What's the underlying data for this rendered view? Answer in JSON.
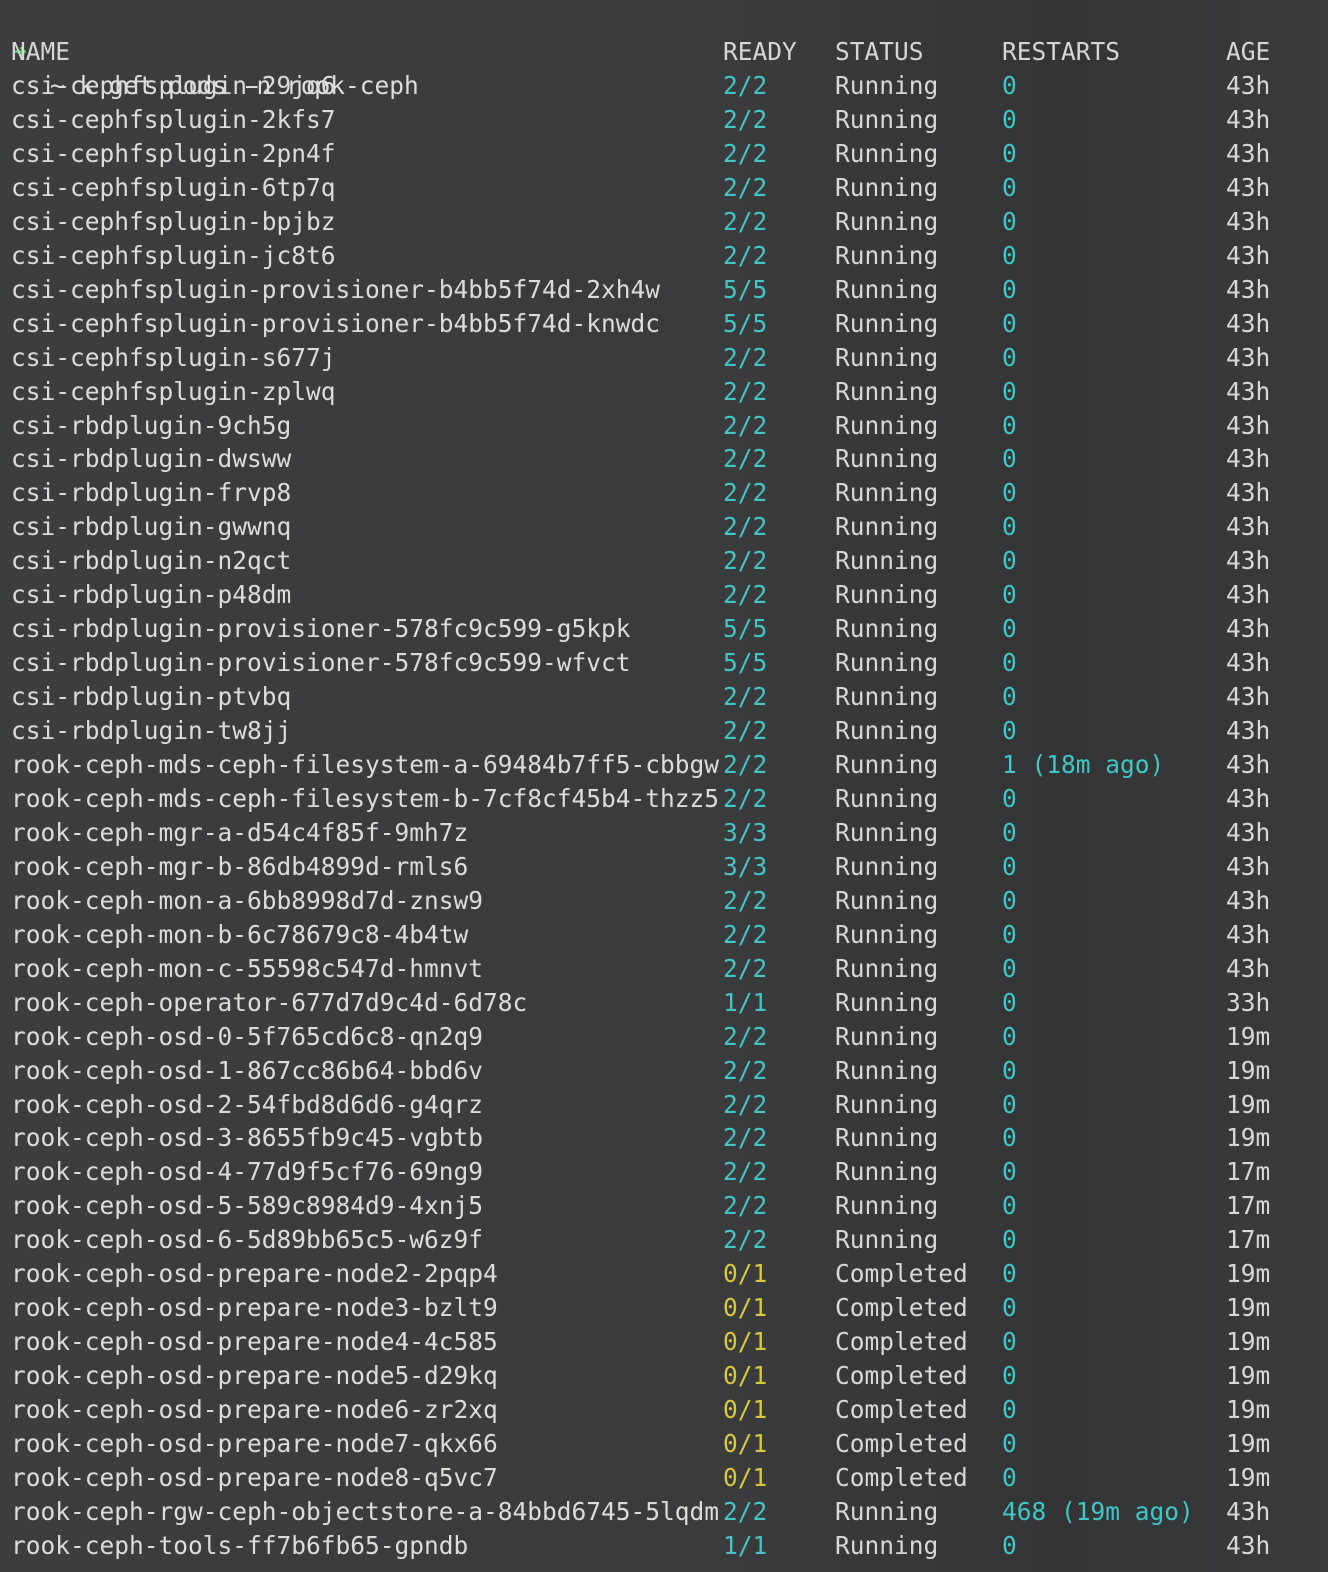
{
  "prompt": {
    "arrow": "➜",
    "command": "~ k get pods -n rook-ceph"
  },
  "headers": {
    "name": "NAME",
    "ready": "READY",
    "status": "STATUS",
    "restarts": "RESTARTS",
    "age": "AGE"
  },
  "colors": {
    "prompt_arrow": "#5fd35f",
    "ready_ok": "#45c4c4",
    "ready_completed": "#d6c93d",
    "restarts": "#3fc7c7",
    "text": "#d8d8d8",
    "background": "#3b3c3d"
  },
  "pods": [
    {
      "name": "csi-cephfsplugin-29jq6",
      "ready": "2/2",
      "status": "Running",
      "restarts": "0",
      "age": "43h"
    },
    {
      "name": "csi-cephfsplugin-2kfs7",
      "ready": "2/2",
      "status": "Running",
      "restarts": "0",
      "age": "43h"
    },
    {
      "name": "csi-cephfsplugin-2pn4f",
      "ready": "2/2",
      "status": "Running",
      "restarts": "0",
      "age": "43h"
    },
    {
      "name": "csi-cephfsplugin-6tp7q",
      "ready": "2/2",
      "status": "Running",
      "restarts": "0",
      "age": "43h"
    },
    {
      "name": "csi-cephfsplugin-bpjbz",
      "ready": "2/2",
      "status": "Running",
      "restarts": "0",
      "age": "43h"
    },
    {
      "name": "csi-cephfsplugin-jc8t6",
      "ready": "2/2",
      "status": "Running",
      "restarts": "0",
      "age": "43h"
    },
    {
      "name": "csi-cephfsplugin-provisioner-b4bb5f74d-2xh4w",
      "ready": "5/5",
      "status": "Running",
      "restarts": "0",
      "age": "43h"
    },
    {
      "name": "csi-cephfsplugin-provisioner-b4bb5f74d-knwdc",
      "ready": "5/5",
      "status": "Running",
      "restarts": "0",
      "age": "43h"
    },
    {
      "name": "csi-cephfsplugin-s677j",
      "ready": "2/2",
      "status": "Running",
      "restarts": "0",
      "age": "43h"
    },
    {
      "name": "csi-cephfsplugin-zplwq",
      "ready": "2/2",
      "status": "Running",
      "restarts": "0",
      "age": "43h"
    },
    {
      "name": "csi-rbdplugin-9ch5g",
      "ready": "2/2",
      "status": "Running",
      "restarts": "0",
      "age": "43h"
    },
    {
      "name": "csi-rbdplugin-dwsww",
      "ready": "2/2",
      "status": "Running",
      "restarts": "0",
      "age": "43h"
    },
    {
      "name": "csi-rbdplugin-frvp8",
      "ready": "2/2",
      "status": "Running",
      "restarts": "0",
      "age": "43h"
    },
    {
      "name": "csi-rbdplugin-gwwnq",
      "ready": "2/2",
      "status": "Running",
      "restarts": "0",
      "age": "43h"
    },
    {
      "name": "csi-rbdplugin-n2qct",
      "ready": "2/2",
      "status": "Running",
      "restarts": "0",
      "age": "43h"
    },
    {
      "name": "csi-rbdplugin-p48dm",
      "ready": "2/2",
      "status": "Running",
      "restarts": "0",
      "age": "43h"
    },
    {
      "name": "csi-rbdplugin-provisioner-578fc9c599-g5kpk",
      "ready": "5/5",
      "status": "Running",
      "restarts": "0",
      "age": "43h"
    },
    {
      "name": "csi-rbdplugin-provisioner-578fc9c599-wfvct",
      "ready": "5/5",
      "status": "Running",
      "restarts": "0",
      "age": "43h"
    },
    {
      "name": "csi-rbdplugin-ptvbq",
      "ready": "2/2",
      "status": "Running",
      "restarts": "0",
      "age": "43h"
    },
    {
      "name": "csi-rbdplugin-tw8jj",
      "ready": "2/2",
      "status": "Running",
      "restarts": "0",
      "age": "43h"
    },
    {
      "name": "rook-ceph-mds-ceph-filesystem-a-69484b7ff5-cbbgw",
      "ready": "2/2",
      "status": "Running",
      "restarts": "1 (18m ago)",
      "age": "43h"
    },
    {
      "name": "rook-ceph-mds-ceph-filesystem-b-7cf8cf45b4-thzz5",
      "ready": "2/2",
      "status": "Running",
      "restarts": "0",
      "age": "43h"
    },
    {
      "name": "rook-ceph-mgr-a-d54c4f85f-9mh7z",
      "ready": "3/3",
      "status": "Running",
      "restarts": "0",
      "age": "43h"
    },
    {
      "name": "rook-ceph-mgr-b-86db4899d-rmls6",
      "ready": "3/3",
      "status": "Running",
      "restarts": "0",
      "age": "43h"
    },
    {
      "name": "rook-ceph-mon-a-6bb8998d7d-znsw9",
      "ready": "2/2",
      "status": "Running",
      "restarts": "0",
      "age": "43h"
    },
    {
      "name": "rook-ceph-mon-b-6c78679c8-4b4tw",
      "ready": "2/2",
      "status": "Running",
      "restarts": "0",
      "age": "43h"
    },
    {
      "name": "rook-ceph-mon-c-55598c547d-hmnvt",
      "ready": "2/2",
      "status": "Running",
      "restarts": "0",
      "age": "43h"
    },
    {
      "name": "rook-ceph-operator-677d7d9c4d-6d78c",
      "ready": "1/1",
      "status": "Running",
      "restarts": "0",
      "age": "33h"
    },
    {
      "name": "rook-ceph-osd-0-5f765cd6c8-qn2q9",
      "ready": "2/2",
      "status": "Running",
      "restarts": "0",
      "age": "19m"
    },
    {
      "name": "rook-ceph-osd-1-867cc86b64-bbd6v",
      "ready": "2/2",
      "status": "Running",
      "restarts": "0",
      "age": "19m"
    },
    {
      "name": "rook-ceph-osd-2-54fbd8d6d6-g4qrz",
      "ready": "2/2",
      "status": "Running",
      "restarts": "0",
      "age": "19m"
    },
    {
      "name": "rook-ceph-osd-3-8655fb9c45-vgbtb",
      "ready": "2/2",
      "status": "Running",
      "restarts": "0",
      "age": "19m"
    },
    {
      "name": "rook-ceph-osd-4-77d9f5cf76-69ng9",
      "ready": "2/2",
      "status": "Running",
      "restarts": "0",
      "age": "17m"
    },
    {
      "name": "rook-ceph-osd-5-589c8984d9-4xnj5",
      "ready": "2/2",
      "status": "Running",
      "restarts": "0",
      "age": "17m"
    },
    {
      "name": "rook-ceph-osd-6-5d89bb65c5-w6z9f",
      "ready": "2/2",
      "status": "Running",
      "restarts": "0",
      "age": "17m"
    },
    {
      "name": "rook-ceph-osd-prepare-node2-2pqp4",
      "ready": "0/1",
      "status": "Completed",
      "restarts": "0",
      "age": "19m"
    },
    {
      "name": "rook-ceph-osd-prepare-node3-bzlt9",
      "ready": "0/1",
      "status": "Completed",
      "restarts": "0",
      "age": "19m"
    },
    {
      "name": "rook-ceph-osd-prepare-node4-4c585",
      "ready": "0/1",
      "status": "Completed",
      "restarts": "0",
      "age": "19m"
    },
    {
      "name": "rook-ceph-osd-prepare-node5-d29kq",
      "ready": "0/1",
      "status": "Completed",
      "restarts": "0",
      "age": "19m"
    },
    {
      "name": "rook-ceph-osd-prepare-node6-zr2xq",
      "ready": "0/1",
      "status": "Completed",
      "restarts": "0",
      "age": "19m"
    },
    {
      "name": "rook-ceph-osd-prepare-node7-qkx66",
      "ready": "0/1",
      "status": "Completed",
      "restarts": "0",
      "age": "19m"
    },
    {
      "name": "rook-ceph-osd-prepare-node8-q5vc7",
      "ready": "0/1",
      "status": "Completed",
      "restarts": "0",
      "age": "19m"
    },
    {
      "name": "rook-ceph-rgw-ceph-objectstore-a-84bbd6745-5lqdm",
      "ready": "2/2",
      "status": "Running",
      "restarts": "468 (19m ago)",
      "age": "43h"
    },
    {
      "name": "rook-ceph-tools-ff7b6fb65-gpndb",
      "ready": "1/1",
      "status": "Running",
      "restarts": "0",
      "age": "43h"
    }
  ]
}
